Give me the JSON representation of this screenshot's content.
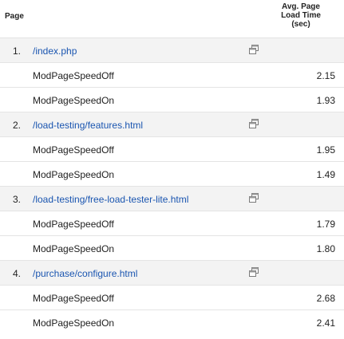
{
  "header": {
    "page_label": "Page",
    "metric_line1": "Avg. Page",
    "metric_line2": "Load Time",
    "metric_line3": "(sec)"
  },
  "rows": [
    {
      "rank": "1.",
      "page": "/index.php",
      "sub": [
        {
          "label": "ModPageSpeedOff",
          "value": "2.15"
        },
        {
          "label": "ModPageSpeedOn",
          "value": "1.93"
        }
      ]
    },
    {
      "rank": "2.",
      "page": "/load-testing/features.html",
      "sub": [
        {
          "label": "ModPageSpeedOff",
          "value": "1.95"
        },
        {
          "label": "ModPageSpeedOn",
          "value": "1.49"
        }
      ]
    },
    {
      "rank": "3.",
      "page": "/load-testing/free-load-tester-lite.html",
      "sub": [
        {
          "label": "ModPageSpeedOff",
          "value": "1.79"
        },
        {
          "label": "ModPageSpeedOn",
          "value": "1.80"
        }
      ]
    },
    {
      "rank": "4.",
      "page": "/purchase/configure.html",
      "sub": [
        {
          "label": "ModPageSpeedOff",
          "value": "2.68"
        },
        {
          "label": "ModPageSpeedOn",
          "value": "2.41"
        }
      ]
    }
  ],
  "icons": {
    "popout": "open-in-new-window-icon"
  },
  "colors": {
    "link": "#1a55b0",
    "group_row_bg": "#f3f3f3",
    "row_border": "#e4e4e4"
  }
}
